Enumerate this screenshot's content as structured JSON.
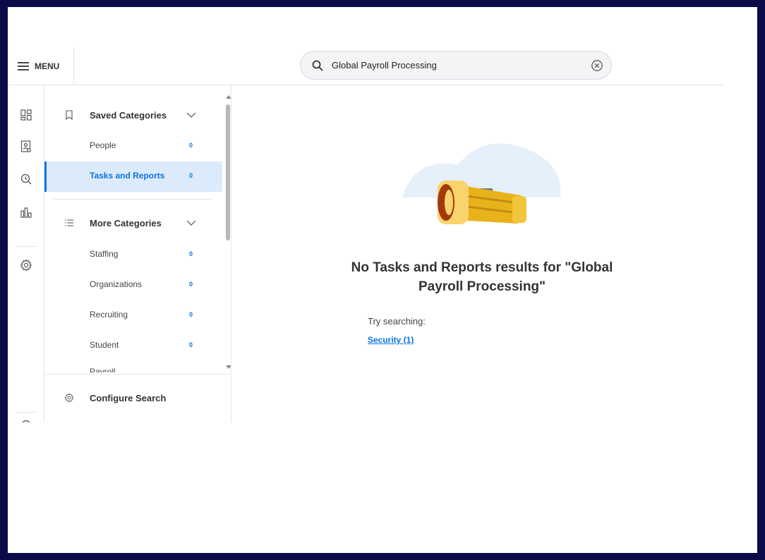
{
  "header": {
    "menu_label": "MENU",
    "search_value": "Global Payroll Processing"
  },
  "rail": {
    "icons": [
      "dashboard-icon",
      "directory-icon",
      "search-icon",
      "chart-icon",
      "gear-icon"
    ]
  },
  "categories": {
    "saved": {
      "title": "Saved Categories",
      "items": [
        {
          "label": "People",
          "count": "0"
        },
        {
          "label": "Tasks and Reports",
          "count": "0",
          "active": true
        }
      ]
    },
    "more": {
      "title": "More Categories",
      "items": [
        {
          "label": "Staffing",
          "count": "0"
        },
        {
          "label": "Organizations",
          "count": "0"
        },
        {
          "label": "Recruiting",
          "count": "0"
        },
        {
          "label": "Student",
          "count": "0"
        },
        {
          "label": "Payroll",
          "count": ""
        }
      ]
    },
    "configure_label": "Configure Search"
  },
  "results": {
    "empty_title_line1": "No Tasks and Reports results for \"Global",
    "empty_title_line2": "Payroll Processing\"",
    "try_label": "Try searching:",
    "suggestion": "Security (1)"
  },
  "colors": {
    "accent": "#0875e1",
    "active_bg": "#dcebfb",
    "frame": "#0b0b4a"
  }
}
